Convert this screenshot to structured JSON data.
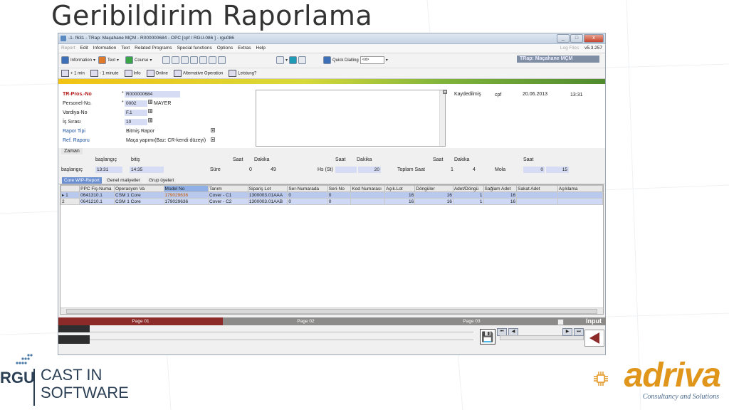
{
  "slide": {
    "title": "Geribildirim Raporlama"
  },
  "window": {
    "title": "-1- f631 - TRap: Maçahane MÇM - R000000684 -   OPC [cpf / RGU-086 ]  - rgu086",
    "buttons": [
      "_",
      "□",
      "x"
    ]
  },
  "menubar": {
    "items": [
      "Report",
      "Edit",
      "Information",
      "Text",
      "Related Programs",
      "Special functions",
      "Options",
      "Extras",
      "Help"
    ],
    "right_dim": "Log Files",
    "version": "v5.3.257"
  },
  "toolbar1": {
    "information": "Information",
    "text": "Text",
    "course": "Course",
    "quick_dialling": "Quick Dialling",
    "quick_value": "<id>",
    "brand": "TRap: Maçahane MÇM"
  },
  "toolbar2": {
    "items": [
      "+ 1 min",
      "- 1 minute",
      "Info",
      "Online",
      "Alternative Operation",
      "Leistung?"
    ]
  },
  "form": {
    "tr_pros_label": "TR-Pros.-No",
    "tr_pros_value": "R000000684",
    "personel_label": "Personel-No.",
    "personel_value": "0002",
    "personel_name": "MAYER",
    "vardiya_label": "Vardiya-No",
    "vardiya_value": "F.1",
    "is_label": "İş Sırası",
    "is_value": "10",
    "rapor_tipi_label": "Rapor Tipi",
    "rapor_tipi_value": "Bitmiş Rapor",
    "ref_label": "Ref. Raporu",
    "ref_value": "Maça yapımı(Baz: CR-kendi düzeyi)",
    "kaydedilmis_label": "Kaydedilmiş",
    "kaydedilmis_user": "cpf",
    "kaydedilmis_date": "20.06.2013",
    "kaydedilmis_time": "13:31"
  },
  "time": {
    "tab": "Zaman",
    "baslangic_head": "başlangıç",
    "bitis_head": "bitiş",
    "row_label": "başlangıç",
    "start": "13:31",
    "end": "14:35",
    "sure_label": "Süre",
    "saat1": "Saat",
    "dakika1": "Dakika",
    "sure_saat": "0",
    "sure_dakika": "49",
    "hs_label": "Hs (St)",
    "saat2": "Saat",
    "dakika2": "Dakika",
    "hs_dakika": "20",
    "toplam_label": "Toplam Saat",
    "saat3": "Saat",
    "dakika3": "Dakika",
    "toplam_saat": "1",
    "toplam_dakika": "4",
    "mola_label": "Mola",
    "saat4": "Saat",
    "mola_saat": "0",
    "mola_dakika": "15"
  },
  "tabs": [
    "Core WIP-Report",
    "Genel maliyetler",
    "Grup üyeleri"
  ],
  "grid": {
    "headers": [
      "",
      "PPC Fiş-Numa",
      "Operasyon Va",
      "Model No",
      "Tanım",
      "Sipariş Lot",
      "Ser-Numarada",
      "Seri-No",
      "Kod Numarası",
      "Açık.Lot",
      "Döngüler",
      "Adet/Döngü",
      "Sağlam Adet",
      "Sakat Adet",
      "Açıklama"
    ],
    "rows": [
      [
        "▸ 1",
        "0641310.1",
        "CSM 1 Core",
        "179029636",
        "Cover - C1",
        "1300003.01AAA",
        "0",
        "0",
        "",
        "16",
        "16",
        "1",
        "16",
        "",
        ""
      ],
      [
        "2",
        "0641210.1",
        "CSM 1 Core",
        "179029636",
        "Cover - C2",
        "1300003.01AAB",
        "0",
        "0",
        "",
        "16",
        "16",
        "1",
        "16",
        "",
        ""
      ]
    ]
  },
  "pages": {
    "page1": "Page 01",
    "page2": "Page 02",
    "page3": "Page 03",
    "input": "Input"
  },
  "logos": {
    "rgu": "RGU",
    "cast_line1": "CAST IN",
    "cast_line2": "SOFTWARE",
    "adriva": "adriva",
    "adriva_sub": "Consultancy and Solutions"
  },
  "colors": {
    "accent_red": "#8c2a2a",
    "grid_blue": "#cfd9f5",
    "brand_orange": "#e0951b"
  }
}
